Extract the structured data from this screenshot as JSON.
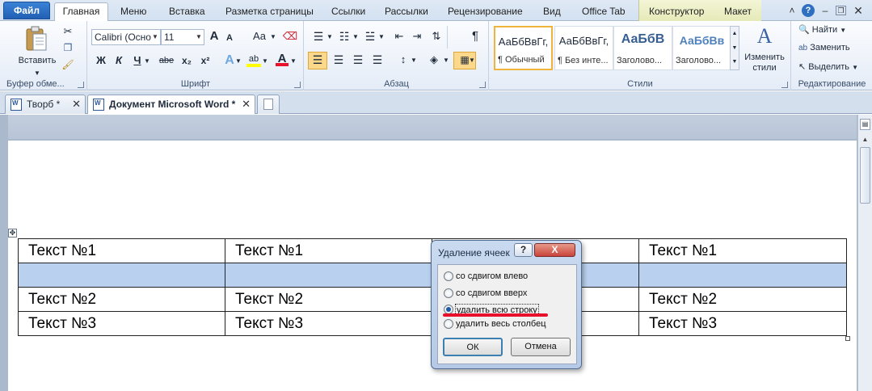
{
  "ribbon_tabs": {
    "file": "Файл",
    "home": "Главная",
    "menu": "Меню",
    "insert": "Вставка",
    "page_layout": "Разметка страницы",
    "references": "Ссылки",
    "mailings": "Рассылки",
    "review": "Рецензирование",
    "view": "Вид",
    "office_tab": "Office Tab",
    "designer": "Конструктор",
    "layout": "Макет"
  },
  "clipboard": {
    "paste_label": "Вставить",
    "group_label": "Буфер обме..."
  },
  "font": {
    "name": "Calibri (Осно",
    "size": "11",
    "grow": "A",
    "shrink": "A",
    "change_case": "Aa",
    "bold": "Ж",
    "italic": "К",
    "underline": "Ч",
    "strike": "abe",
    "subscript": "x₂",
    "superscript": "x²",
    "group_label": "Шрифт"
  },
  "paragraph": {
    "group_label": "Абзац"
  },
  "styles": {
    "group_label": "Стили",
    "cards": [
      {
        "sample": "АаБбВвГг,",
        "name": "¶ Обычный"
      },
      {
        "sample": "АаБбВвГг,",
        "name": "¶ Без инте..."
      },
      {
        "sample": "АаБбВ",
        "name": "Заголово..."
      },
      {
        "sample": "АаБбВв",
        "name": "Заголово..."
      }
    ],
    "change_styles": "Изменить стили"
  },
  "editing": {
    "find": "Найти",
    "replace": "Заменить",
    "select": "Выделить",
    "group_label": "Редактирование"
  },
  "doc_tabs": [
    {
      "label": "Творб *"
    },
    {
      "label": "Документ Microsoft Word *"
    }
  ],
  "table": {
    "rows": [
      [
        "Текст №1",
        "Текст №1",
        "",
        "Текст №1"
      ],
      [
        "",
        "",
        "",
        ""
      ],
      [
        "Текст №2",
        "Текст №2",
        "",
        "Текст №2"
      ],
      [
        "Текст №3",
        "Текст №3",
        "",
        "Текст №3"
      ]
    ],
    "selected_row": 1
  },
  "dialog": {
    "title": "Удаление ячеек",
    "help": "?",
    "close": "X",
    "options": [
      {
        "label": "со сдвигом влево",
        "checked": false
      },
      {
        "label": "со сдвигом вверх",
        "checked": false
      },
      {
        "label": "удалить всю строку",
        "checked": true
      },
      {
        "label": "удалить весь столбец",
        "checked": false
      }
    ],
    "ok": "ОК",
    "cancel": "Отмена"
  },
  "colors": {
    "accent": "#2b5797",
    "selection": "#b9d1ee",
    "highlight_underline": "#e8102a",
    "font_color": "#e8102a",
    "highlight_color": "#ffff00"
  }
}
